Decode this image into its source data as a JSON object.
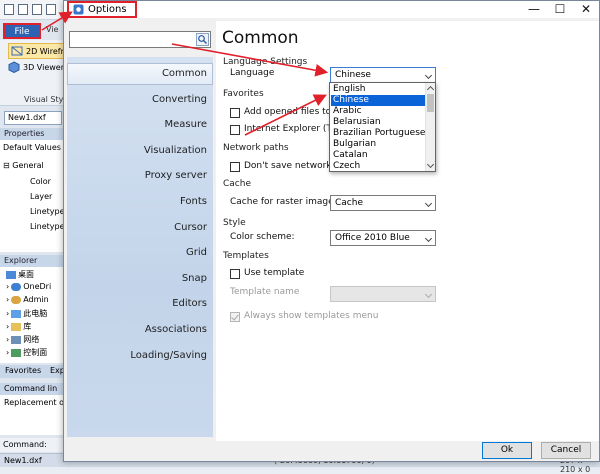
{
  "app": {
    "file_tab": "File",
    "view_tab": "Vie",
    "ribbon": {
      "wireframe": "2D Wirefr",
      "viewer3d": "3D Viewer",
      "visual_style": "Visual Styl"
    },
    "doc_tab": "New1.dxf",
    "properties": {
      "title": "Properties",
      "selector": "Default Values",
      "group": "General",
      "rows": [
        "Color",
        "Layer",
        "Linetype",
        "Linetype"
      ]
    },
    "explorer": {
      "title": "Explorer",
      "items": [
        "桌面",
        "OneDri",
        "Admin",
        "此电脑",
        "库",
        "网络",
        "控制面"
      ]
    },
    "bottom_tabs": [
      "Favorites",
      "Exp"
    ],
    "command_line": {
      "title": "Command lin",
      "text": "Replacement o"
    },
    "command_label": "Command:",
    "status": {
      "file": "New1.dxf",
      "coords": "(-20.45089, 10.61706, 0)",
      "size": "297 x 210 x 0"
    }
  },
  "dialog": {
    "title": "Options",
    "window_buttons": {
      "minimize": "—",
      "maximize": "☐",
      "close": "✕"
    },
    "search": {
      "value": "",
      "placeholder": ""
    },
    "nav_items": [
      "Common",
      "Converting",
      "Measure",
      "Visualization",
      "Proxy server",
      "Fonts",
      "Cursor",
      "Grid",
      "Snap",
      "Editors",
      "Associations",
      "Loading/Saving"
    ],
    "active_nav": "Common",
    "heading": "Common",
    "language": {
      "section": "Language Settings",
      "label": "Language",
      "value": "Chinese",
      "options": [
        "English",
        "Chinese",
        "Arabic",
        "Belarusian",
        "Brazilian Portuguese",
        "Bulgarian",
        "Catalan",
        "Czech"
      ],
      "selected_index": 1
    },
    "favorites": {
      "section": "Favorites",
      "add_opened": "Add opened files to fa",
      "ie": "Internet Explorer (TM)"
    },
    "network": {
      "section": "Network paths",
      "dont_save": "Don't save network pat"
    },
    "cache": {
      "section": "Cache",
      "label": "Cache for raster images:",
      "value": "Cache"
    },
    "style": {
      "section": "Style",
      "label": "Color scheme:",
      "value": "Office 2010 Blue"
    },
    "templates": {
      "section": "Templates",
      "use_template": "Use template",
      "template_name": "Template name",
      "always_show": "Always show templates menu"
    },
    "buttons": {
      "ok": "Ok",
      "cancel": "Cancel"
    }
  },
  "colors": {
    "accent": "#2e63b3",
    "annotation": "#e0202a",
    "selection": "#0a64d8",
    "nav_bg": "#c9d8ec"
  }
}
